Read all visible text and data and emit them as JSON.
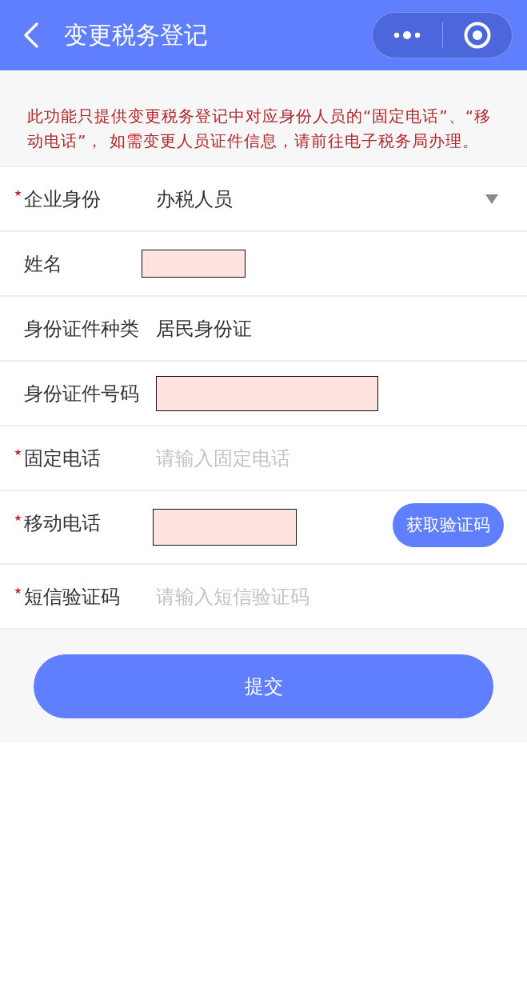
{
  "nav_bar": {
    "title": "变更税务登记"
  },
  "notice": "此功能只提供变更税务登记中对应身份人员的“固定电话”、“移动电话”， 如需变更人员证件信息，请前往电子税务局办理。",
  "form": {
    "rows": [
      {
        "kind": "select",
        "label": "企业身份",
        "required": true,
        "value": "办税人员"
      },
      {
        "kind": "text",
        "label": "姓名",
        "required": false,
        "redacted": true
      },
      {
        "kind": "text",
        "label": "身份证件种类",
        "required": false,
        "value": "居民身份证"
      },
      {
        "kind": "text",
        "label": "身份证件号码",
        "required": false,
        "redacted": true
      },
      {
        "kind": "input",
        "label": "固定电话",
        "required": true,
        "placeholder": "请输入固定电话"
      },
      {
        "kind": "input",
        "label": "移动电话",
        "required": true,
        "redacted": true,
        "action": "获取验证码"
      },
      {
        "kind": "input",
        "label": "短信验证码",
        "required": true,
        "placeholder": "请输入短信验证码"
      }
    ]
  },
  "submit_button": "提交"
}
